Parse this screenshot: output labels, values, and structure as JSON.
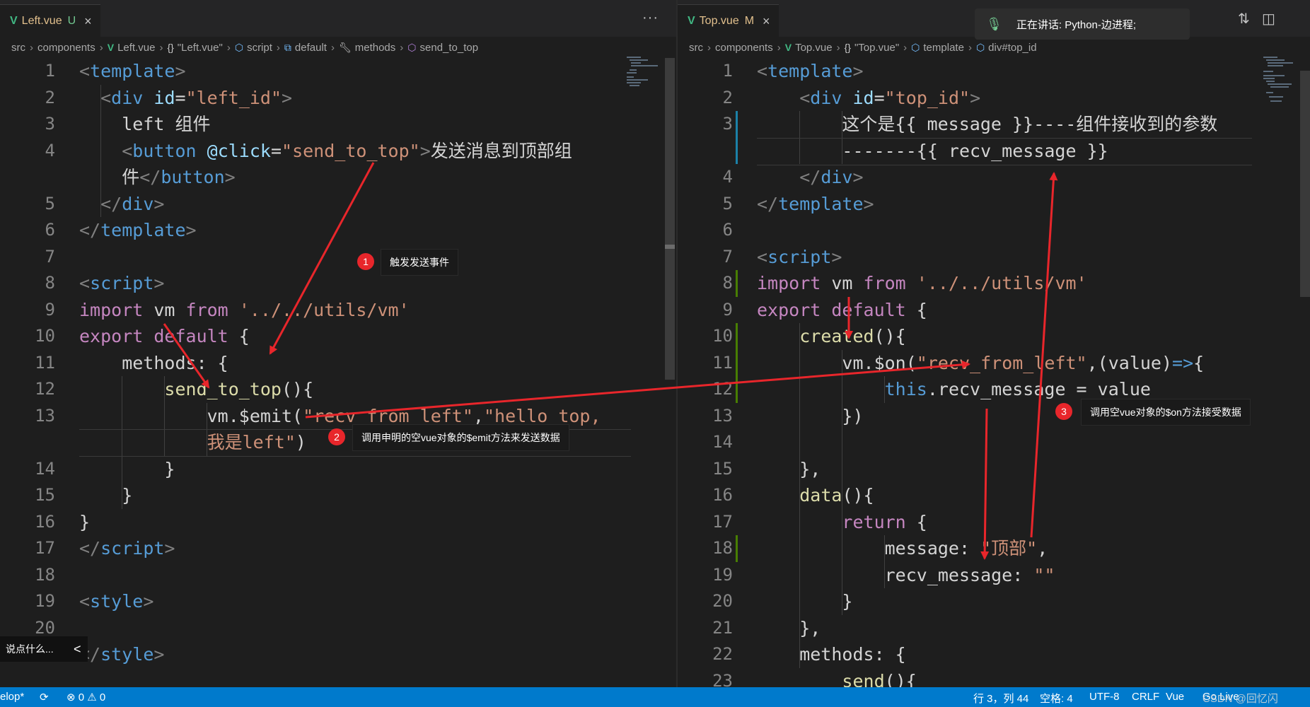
{
  "left": {
    "tab": {
      "filename": "Left.vue",
      "status": "U"
    },
    "more": "···",
    "breadcrumbs": [
      "src",
      "components",
      "Left.vue",
      "\"Left.vue\"",
      "script",
      "default",
      "methods",
      "send_to_top"
    ],
    "line_numbers": [
      "1",
      "2",
      "3",
      "4",
      "",
      "5",
      "6",
      "7",
      "8",
      "9",
      "10",
      "11",
      "12",
      "13",
      "",
      "14",
      "15",
      "16",
      "17",
      "18",
      "19",
      "20",
      ""
    ],
    "lines": [
      [
        [
          "t-br",
          "<"
        ],
        [
          "t-tag",
          "template"
        ],
        [
          "t-br",
          ">"
        ]
      ],
      [
        [
          "t-txt",
          "  "
        ],
        [
          "t-br",
          "<"
        ],
        [
          "t-tag",
          "div"
        ],
        [
          "t-txt",
          " "
        ],
        [
          "t-attr",
          "id"
        ],
        [
          "t-txt",
          "="
        ],
        [
          "t-str",
          "\"left_id\""
        ],
        [
          "t-br",
          ">"
        ]
      ],
      [
        [
          "t-txt",
          "    left 组件"
        ]
      ],
      [
        [
          "t-txt",
          "    "
        ],
        [
          "t-br",
          "<"
        ],
        [
          "t-tag",
          "button"
        ],
        [
          "t-txt",
          " "
        ],
        [
          "t-attr",
          "@click"
        ],
        [
          "t-txt",
          "="
        ],
        [
          "t-str",
          "\"send_to_top\""
        ],
        [
          "t-br",
          ">"
        ],
        [
          "t-txt",
          "发送消息到顶部组"
        ]
      ],
      [
        [
          "t-txt",
          "    件"
        ],
        [
          "t-br",
          "</"
        ],
        [
          "t-tag",
          "button"
        ],
        [
          "t-br",
          ">"
        ]
      ],
      [
        [
          "t-txt",
          "  "
        ],
        [
          "t-br",
          "</"
        ],
        [
          "t-tag",
          "div"
        ],
        [
          "t-br",
          ">"
        ]
      ],
      [
        [
          "t-br",
          "</"
        ],
        [
          "t-tag",
          "template"
        ],
        [
          "t-br",
          ">"
        ]
      ],
      [
        [
          "t-txt",
          ""
        ]
      ],
      [
        [
          "t-br",
          "<"
        ],
        [
          "t-tag",
          "script"
        ],
        [
          "t-br",
          ">"
        ]
      ],
      [
        [
          "t-ctl",
          "import"
        ],
        [
          "t-txt",
          " vm "
        ],
        [
          "t-ctl",
          "from"
        ],
        [
          "t-txt",
          " "
        ],
        [
          "t-str",
          "'../../utils/vm'"
        ]
      ],
      [
        [
          "t-ctl",
          "export"
        ],
        [
          "t-txt",
          " "
        ],
        [
          "t-ctl",
          "default"
        ],
        [
          "t-txt",
          " {"
        ]
      ],
      [
        [
          "t-txt",
          "    methods: {"
        ]
      ],
      [
        [
          "t-txt",
          "        "
        ],
        [
          "t-fn",
          "send_to_top"
        ],
        [
          "t-txt",
          "(){"
        ]
      ],
      [
        [
          "t-txt",
          "            vm.$emit("
        ],
        [
          "t-str",
          "\"recv_from_left\""
        ],
        [
          "t-txt",
          ","
        ],
        [
          "t-str",
          "\"hello top,"
        ]
      ],
      [
        [
          "t-txt",
          "            "
        ],
        [
          "t-str",
          "我是left\""
        ],
        [
          "t-txt",
          ")"
        ]
      ],
      [
        [
          "t-txt",
          "        }"
        ]
      ],
      [
        [
          "t-txt",
          "    }"
        ]
      ],
      [
        [
          "t-txt",
          "}"
        ]
      ],
      [
        [
          "t-br",
          "</"
        ],
        [
          "t-tag",
          "script"
        ],
        [
          "t-br",
          ">"
        ]
      ],
      [
        [
          "t-txt",
          ""
        ]
      ],
      [
        [
          "t-br",
          "<"
        ],
        [
          "t-tag",
          "style"
        ],
        [
          "t-br",
          ">"
        ]
      ],
      [
        [
          "t-txt",
          ""
        ]
      ],
      [
        [
          "t-br",
          "</"
        ],
        [
          "t-tag",
          "style"
        ],
        [
          "t-br",
          ">"
        ]
      ]
    ]
  },
  "right": {
    "tab": {
      "filename": "Top.vue",
      "status": "M"
    },
    "breadcrumbs": [
      "src",
      "components",
      "Top.vue",
      "\"Top.vue\"",
      "template",
      "div#top_id"
    ],
    "line_numbers": [
      "1",
      "2",
      "3",
      "",
      "4",
      "5",
      "6",
      "7",
      "8",
      "9",
      "10",
      "11",
      "12",
      "13",
      "14",
      "15",
      "16",
      "17",
      "18",
      "19",
      "20",
      "21",
      "22",
      "23"
    ],
    "lines": [
      [
        [
          "t-br",
          "<"
        ],
        [
          "t-tag",
          "template"
        ],
        [
          "t-br",
          ">"
        ]
      ],
      [
        [
          "t-txt",
          "    "
        ],
        [
          "t-br",
          "<"
        ],
        [
          "t-tag",
          "div"
        ],
        [
          "t-txt",
          " "
        ],
        [
          "t-attr",
          "id"
        ],
        [
          "t-txt",
          "="
        ],
        [
          "t-str",
          "\"top_id\""
        ],
        [
          "t-br",
          ">"
        ]
      ],
      [
        [
          "t-txt",
          "        这个是{{ message }}----组件接收到的参数"
        ]
      ],
      [
        [
          "t-txt",
          "        -------{{ recv_message }}"
        ]
      ],
      [
        [
          "t-txt",
          "    "
        ],
        [
          "t-br",
          "</"
        ],
        [
          "t-tag",
          "div"
        ],
        [
          "t-br",
          ">"
        ]
      ],
      [
        [
          "t-br",
          "</"
        ],
        [
          "t-tag",
          "template"
        ],
        [
          "t-br",
          ">"
        ]
      ],
      [
        [
          "t-txt",
          ""
        ]
      ],
      [
        [
          "t-br",
          "<"
        ],
        [
          "t-tag",
          "script"
        ],
        [
          "t-br",
          ">"
        ]
      ],
      [
        [
          "t-ctl",
          "import"
        ],
        [
          "t-txt",
          " vm "
        ],
        [
          "t-ctl",
          "from"
        ],
        [
          "t-txt",
          " "
        ],
        [
          "t-str",
          "'../../utils/vm'"
        ]
      ],
      [
        [
          "t-ctl",
          "export"
        ],
        [
          "t-txt",
          " "
        ],
        [
          "t-ctl",
          "default"
        ],
        [
          "t-txt",
          " {"
        ]
      ],
      [
        [
          "t-txt",
          "    "
        ],
        [
          "t-fn",
          "created"
        ],
        [
          "t-txt",
          "(){"
        ]
      ],
      [
        [
          "t-txt",
          "        vm.$on("
        ],
        [
          "t-str",
          "\"recv_from_left\""
        ],
        [
          "t-txt",
          ",(value)"
        ],
        [
          "t-kw",
          "=>"
        ],
        [
          "t-txt",
          "{"
        ]
      ],
      [
        [
          "t-txt",
          "            "
        ],
        [
          "t-kw",
          "this"
        ],
        [
          "t-txt",
          ".recv_message = value"
        ]
      ],
      [
        [
          "t-txt",
          "        })"
        ]
      ],
      [
        [
          "t-txt",
          ""
        ]
      ],
      [
        [
          "t-txt",
          "    },"
        ]
      ],
      [
        [
          "t-txt",
          "    "
        ],
        [
          "t-fn",
          "data"
        ],
        [
          "t-txt",
          "(){"
        ]
      ],
      [
        [
          "t-txt",
          "        "
        ],
        [
          "t-ctl",
          "return"
        ],
        [
          "t-txt",
          " {"
        ]
      ],
      [
        [
          "t-txt",
          "            message: "
        ],
        [
          "t-str",
          "\"顶部\""
        ],
        [
          "t-txt",
          ","
        ]
      ],
      [
        [
          "t-txt",
          "            recv_message: "
        ],
        [
          "t-str",
          "\"\""
        ]
      ],
      [
        [
          "t-txt",
          "        }"
        ]
      ],
      [
        [
          "t-txt",
          "    },"
        ]
      ],
      [
        [
          "t-txt",
          "    methods: {"
        ]
      ],
      [
        [
          "t-txt",
          "        "
        ],
        [
          "t-fn",
          "send"
        ],
        [
          "t-txt",
          "(){"
        ]
      ]
    ]
  },
  "voice": {
    "text": "正在讲话: Python-边进程;"
  },
  "callouts": [
    {
      "num": "1",
      "text": "触发发送事件"
    },
    {
      "num": "2",
      "text": "调用申明的空vue对象的$emit方法来发送数据"
    },
    {
      "num": "3",
      "text": "调用空vue对象的$on方法接受数据"
    }
  ],
  "chat": {
    "placeholder": "说点什么...",
    "chevron": "<"
  },
  "status": {
    "branch": "elop*",
    "errors": "0",
    "warnings": "0",
    "position": "行 3，列 44",
    "spaces": "空格: 4",
    "encoding": "UTF-8",
    "eol": "CRLF",
    "language": "Vue",
    "live": "Go Live",
    "watermark": "CSDN @回忆闪"
  },
  "colors": {
    "accent": "#007acc",
    "vue": "#41b883",
    "arrow": "#e8262b"
  }
}
